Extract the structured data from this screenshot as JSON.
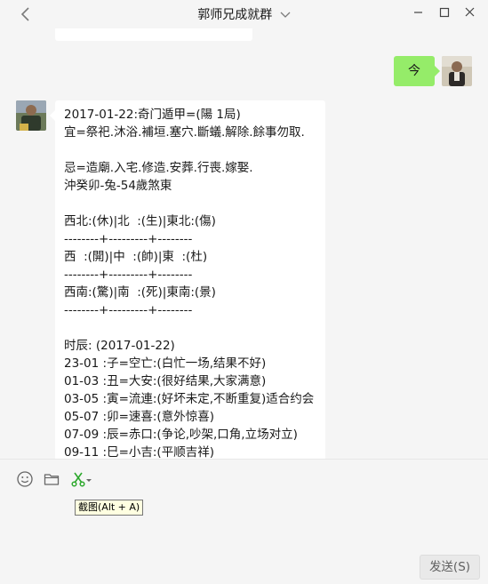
{
  "window": {
    "title": "郭师兄成就群"
  },
  "chat": {
    "outgoing": {
      "text": "今"
    },
    "incoming_lines": [
      "2017-01-22:奇门遁甲=(陽 1局)",
      "宜=祭祀.沐浴.補垣.塞穴.斷蟻.解除.餘事勿取.",
      "",
      "忌=造廟.入宅.修造.安葬.行喪.嫁娶.",
      "沖癸卯-兔-54歲煞東",
      "",
      "西北:(休)|北  :(生)|東北:(傷)",
      "--------+---------+--------",
      "西  :(開)|中  :(帥)|東  :(杜)",
      "--------+---------+--------",
      "西南:(驚)|南  :(死)|東南:(景)",
      "--------+---------+--------",
      "",
      "时辰: (2017-01-22)",
      "23-01 :子=空亡:(白忙一场,结果不好)",
      "01-03 :丑=大安:(很好结果,大家满意)",
      "03-05 :寅=流連:(好坏未定,不断重复)适合约会",
      "05-07 :卯=速喜:(意外惊喜)",
      "07-09 :辰=赤口:(争论,吵架,口角,立场对立)",
      "09-11 :巳=小吉:(平顺吉祥)"
    ]
  },
  "toolbar": {
    "tooltip": "截图(Alt + A)",
    "send_label": "发送(S)"
  },
  "colors": {
    "outgoing_bubble": "#95ec69",
    "background": "#f5f5f5",
    "scissors_icon": "#2ca82c"
  }
}
